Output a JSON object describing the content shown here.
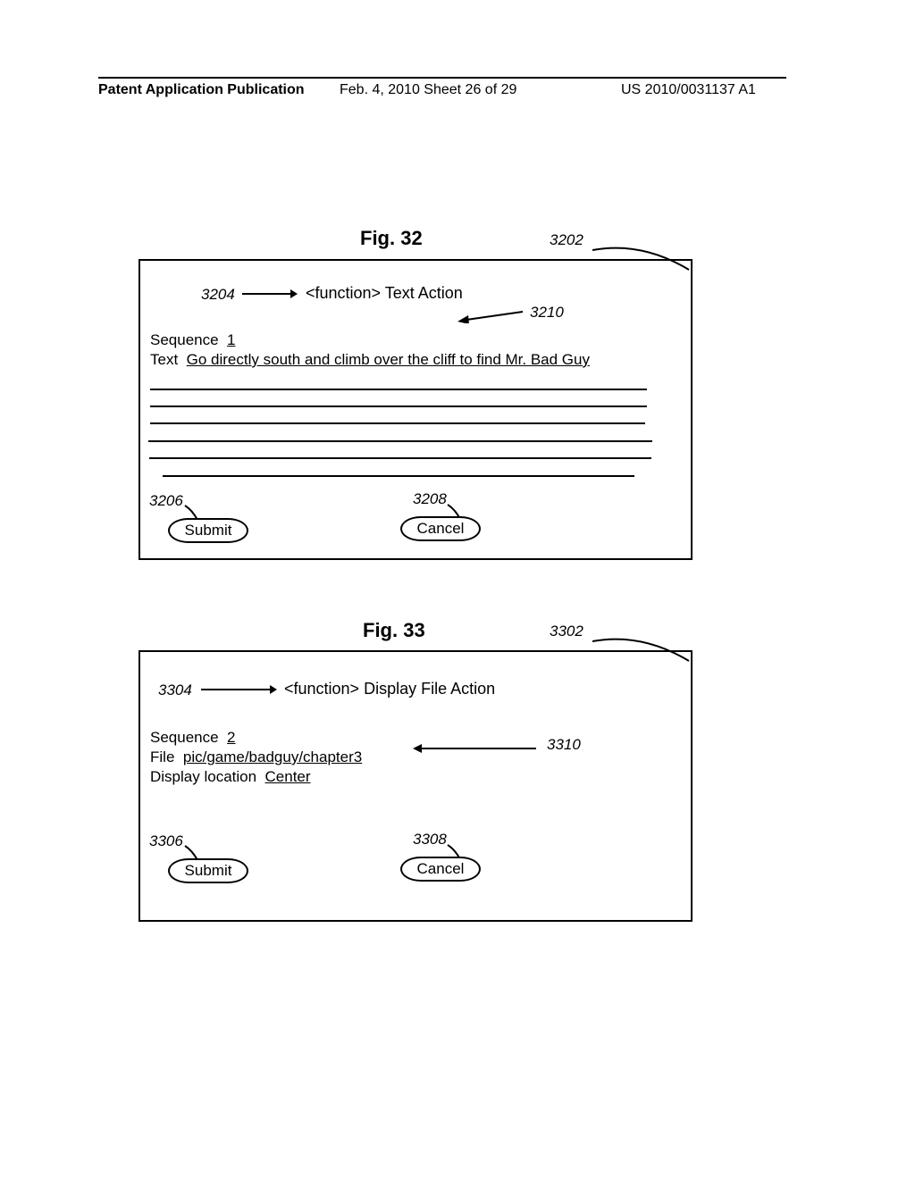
{
  "header": {
    "left": "Patent Application Publication",
    "mid": "Feb. 4, 2010  Sheet 26 of 29",
    "right": "US 2010/0031137 A1"
  },
  "fig32": {
    "title": "Fig. 32",
    "callout_box": "3202",
    "heading": "<function> Text Action",
    "callout_heading": "3204",
    "callout_body": "3210",
    "seq_label": "Sequence",
    "seq_value": "1",
    "text_label": "Text",
    "text_value": "Go directly south and climb over the cliff to find Mr. Bad Guy",
    "submit_label": "Submit",
    "cancel_label": "Cancel",
    "callout_submit": "3206",
    "callout_cancel": "3208"
  },
  "fig33": {
    "title": "Fig. 33",
    "callout_box": "3302",
    "heading": "<function> Display File Action",
    "callout_heading": "3304",
    "callout_body": "3310",
    "seq_label": "Sequence",
    "seq_value": "2",
    "file_label": "File",
    "file_value": "pic/game/badguy/chapter3",
    "loc_label": "Display location",
    "loc_value": "Center",
    "submit_label": "Submit",
    "cancel_label": "Cancel",
    "callout_submit": "3306",
    "callout_cancel": "3308"
  }
}
